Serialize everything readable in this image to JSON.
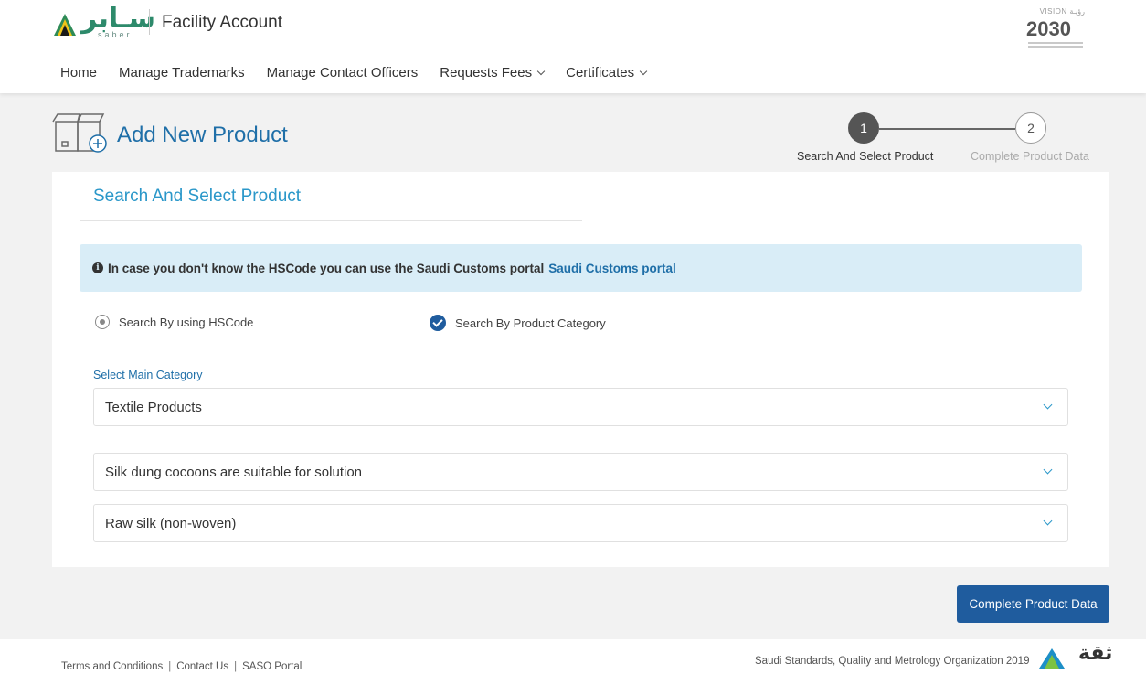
{
  "header": {
    "logo_arabic": "سـابر",
    "logo_latin": "saber",
    "app_title": "Facility Account",
    "vision_small": "VISION رؤيـة",
    "vision_year": "2030"
  },
  "nav": {
    "items": [
      {
        "label": "Home"
      },
      {
        "label": "Manage Trademarks"
      },
      {
        "label": "Manage Contact Officers"
      },
      {
        "label": "Requests Fees"
      },
      {
        "label": "Certificates"
      }
    ]
  },
  "page": {
    "title": "Add New Product"
  },
  "stepper": {
    "steps": [
      {
        "number": "1",
        "label": "Search And Select Product",
        "state": "active"
      },
      {
        "number": "2",
        "label": "Complete Product Data",
        "state": "inactive"
      }
    ]
  },
  "card": {
    "title": "Search And Select Product",
    "alert_text": "In case you don't know the HSCode you can use the Saudi Customs portal",
    "alert_link": "Saudi Customs portal",
    "radio_hscode": "Search By using HSCode",
    "radio_category": "Search By Product Category",
    "selected_mode": "category",
    "main_category_label": "Select Main Category",
    "selects": [
      {
        "value": "Textile Products"
      },
      {
        "value": "Silk dung cocoons are suitable for solution"
      },
      {
        "value": "Raw silk (non-woven)"
      }
    ]
  },
  "actions": {
    "complete_button": "Complete Product Data"
  },
  "footer": {
    "links": [
      "Terms and Conditions",
      "Contact Us",
      "SASO Portal"
    ],
    "separator": "|",
    "copyright": "Saudi Standards, Quality and Metrology Organization  2019",
    "thiqa": "ثقة"
  },
  "colors": {
    "primary": "#1f5c9e",
    "accent": "#2a97c9",
    "alert_bg": "#d9edf7",
    "page_bg": "#f2f2f2"
  }
}
